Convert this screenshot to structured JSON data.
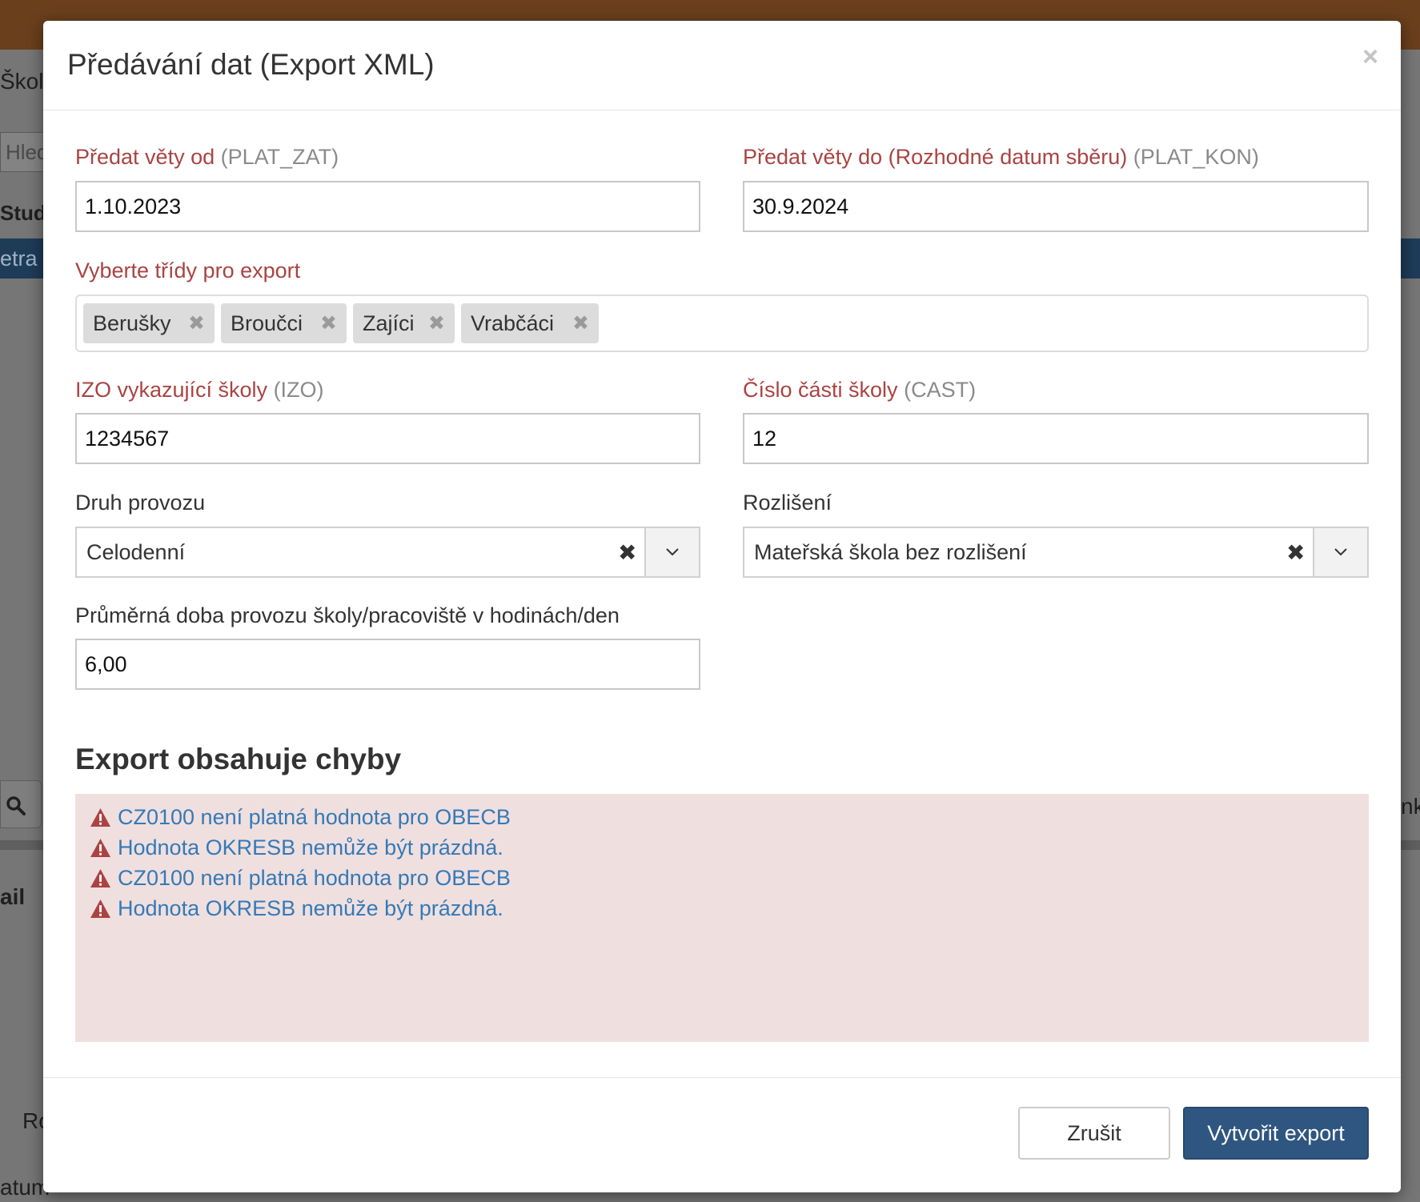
{
  "background": {
    "tab_text": "Školk",
    "search_placeholder": "Hled",
    "column_header": "Stude",
    "row_text": "etra",
    "detail_title": "ail",
    "ro_text": "Ro",
    "datum_text": "atum",
    "right_text": "nk"
  },
  "modal": {
    "title": "Předávání dat (Export XML)",
    "close_label": "×"
  },
  "form": {
    "from": {
      "label": "Předat věty od",
      "hint": "(PLAT_ZAT)",
      "value": "1.10.2023"
    },
    "to": {
      "label": "Předat věty do (Rozhodné datum sběru)",
      "hint": "(PLAT_KON)",
      "value": "30.9.2024"
    },
    "classes": {
      "label": "Vyberte třídy pro export",
      "tags": [
        "Berušky",
        "Broučci",
        "Zajíci",
        "Vrabčáci"
      ],
      "remove_label": "✖"
    },
    "izo": {
      "label": "IZO vykazující školy",
      "hint": "(IZO)",
      "value": "1234567"
    },
    "cast": {
      "label": "Číslo části školy",
      "hint": "(CAST)",
      "value": "12"
    },
    "druh": {
      "label": "Druh provozu",
      "value": "Celodenní",
      "clear_label": "✖"
    },
    "rozliseni": {
      "label": "Rozlišení",
      "value": "Mateřská škola bez rozlišení",
      "clear_label": "✖"
    },
    "doba": {
      "label": "Průměrná doba provozu školy/pracoviště v hodinách/den",
      "value": "6,00"
    }
  },
  "errors": {
    "title": "Export obsahuje chyby",
    "items": [
      "CZ0100 není platná hodnota pro OBECB",
      "Hodnota OKRESB nemůže být prázdná.",
      "CZ0100 není platná hodnota pro OBECB",
      "Hodnota OKRESB nemůže být prázdná."
    ],
    "icon": "warning-icon",
    "color": "#a94442",
    "link_color": "#337ab7",
    "box_color": "#f0dfdf"
  },
  "footer": {
    "cancel_label": "Zrušit",
    "submit_label": "Vytvořit export"
  },
  "colors": {
    "primary": "#2f5680",
    "required_label": "#a94442",
    "topbar": "#6a3f1c"
  }
}
